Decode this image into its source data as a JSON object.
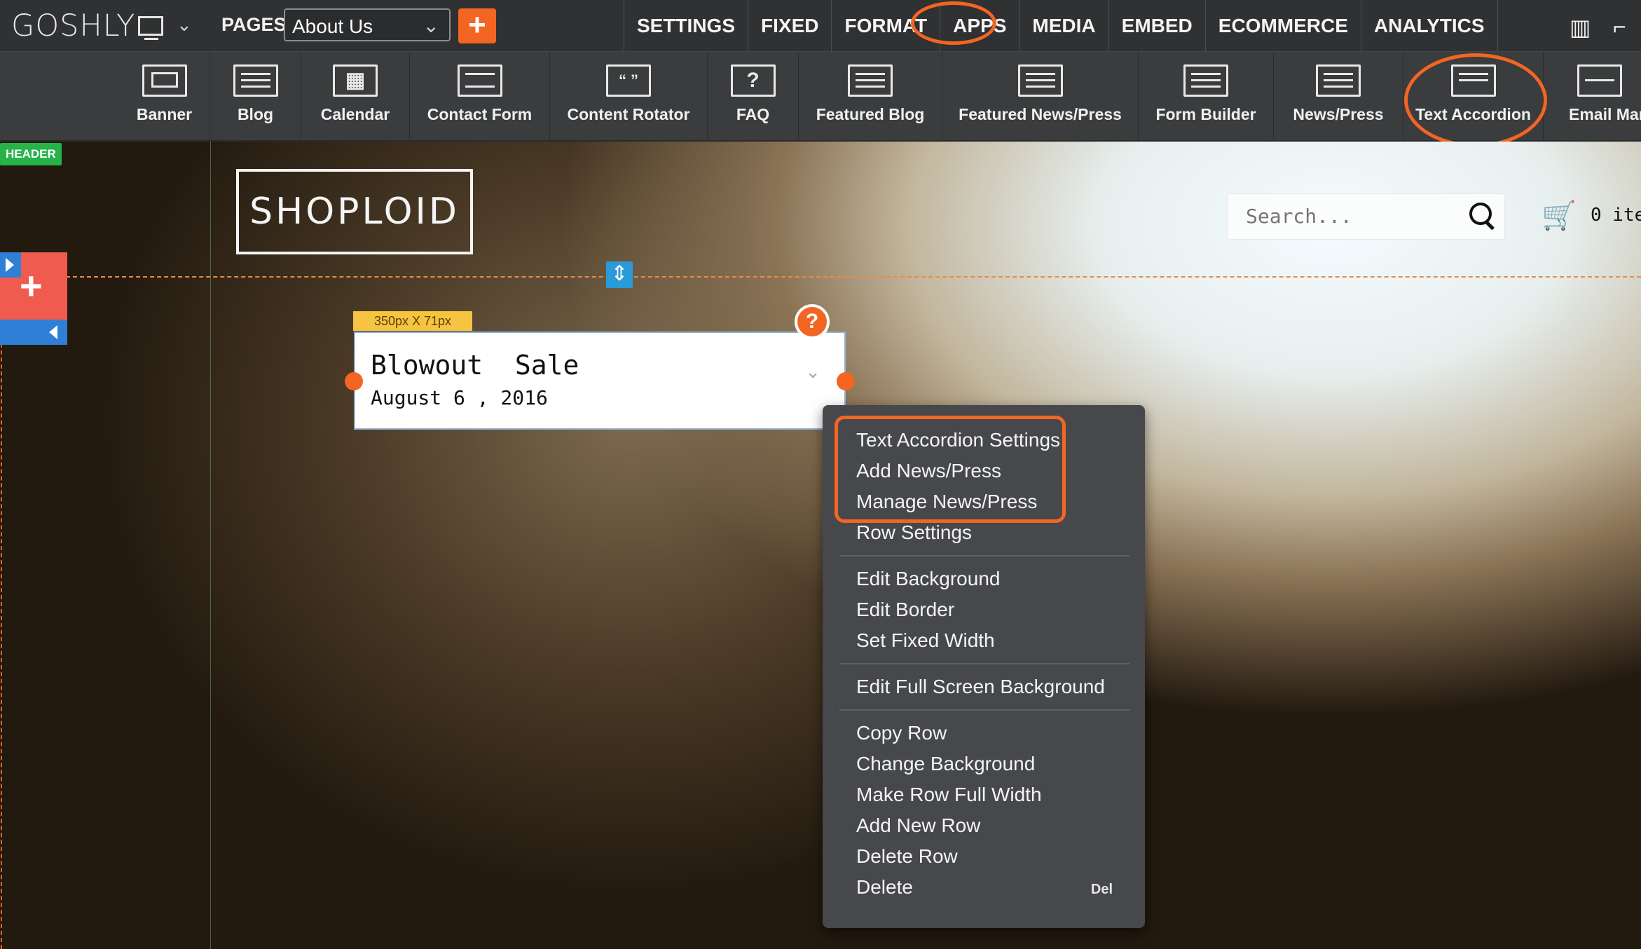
{
  "topbar": {
    "logo": "GOSHLY",
    "pages_label": "PAGES",
    "current_page": "About Us",
    "add_label": "+",
    "menu": [
      "SETTINGS",
      "FIXED",
      "FORMAT",
      "APPS",
      "MEDIA",
      "EMBED",
      "ECOMMERCE",
      "ANALYTICS"
    ],
    "highlighted_menu": "APPS"
  },
  "apps": [
    {
      "label": "Banner",
      "icon": "banner-icon"
    },
    {
      "label": "Blog",
      "icon": "blog-icon"
    },
    {
      "label": "Calendar",
      "icon": "calendar-icon"
    },
    {
      "label": "Contact Form",
      "icon": "contact-form-icon"
    },
    {
      "label": "Content Rotator",
      "icon": "content-rotator-icon"
    },
    {
      "label": "FAQ",
      "icon": "faq-icon"
    },
    {
      "label": "Featured Blog",
      "icon": "featured-blog-icon"
    },
    {
      "label": "Featured News/Press",
      "icon": "featured-news-icon"
    },
    {
      "label": "Form Builder",
      "icon": "form-builder-icon"
    },
    {
      "label": "News/Press",
      "icon": "news-press-icon"
    },
    {
      "label": "Text Accordion",
      "icon": "text-accordion-icon"
    },
    {
      "label": "Email Mar",
      "icon": "email-marketing-icon"
    }
  ],
  "canvas": {
    "header_tag": "HEADER",
    "site_logo": "SHOPLOID",
    "search_placeholder": "Search...",
    "cart_text": "0 ite",
    "size_tag": "350px X 71px",
    "help": "?",
    "widget": {
      "title": "Blowout  Sale",
      "date": "August 6 , 2016"
    }
  },
  "context_menu": {
    "items": [
      "Text Accordion Settings",
      "Add News/Press",
      "Manage News/Press",
      "Row Settings",
      "Edit Background",
      "Edit Border",
      "Set Fixed Width",
      "Edit Full Screen Background",
      "Copy Row",
      "Change Background",
      "Make Row Full Width",
      "Add New Row",
      "Delete Row",
      "Delete"
    ],
    "delete_shortcut": "Del"
  },
  "colors": {
    "accent": "#f26522",
    "topbar": "#2f3133",
    "appbar": "#3a3c3e",
    "menu_bg": "#46484b",
    "header_tag": "#27b24a"
  }
}
